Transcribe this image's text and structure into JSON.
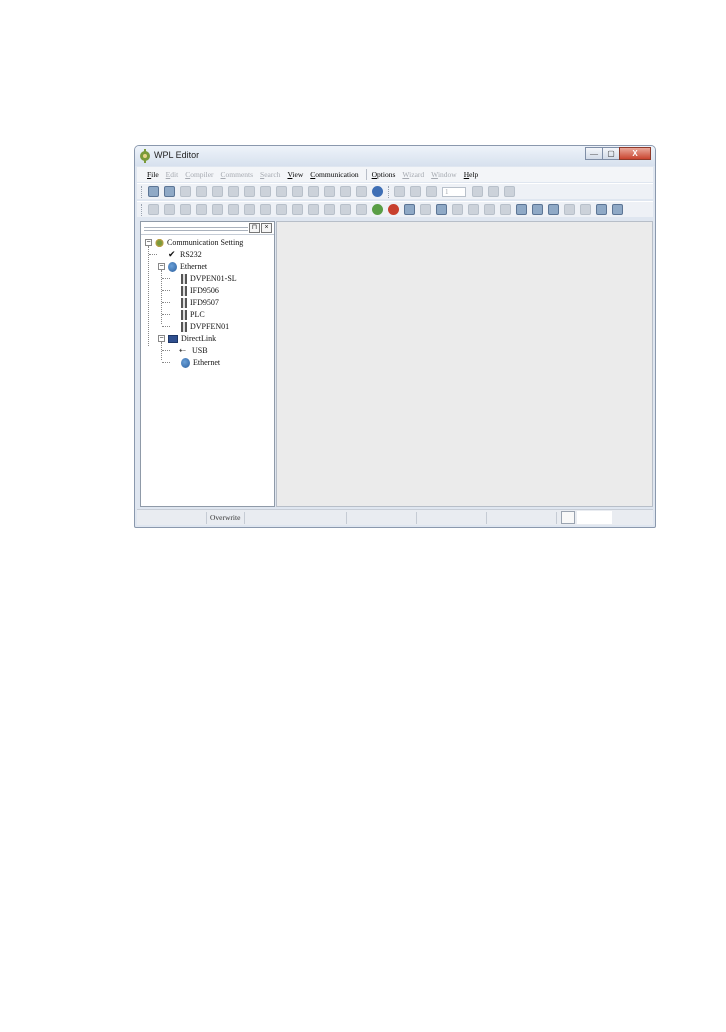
{
  "window": {
    "title": "WPL Editor",
    "controls": {
      "minimize": "—",
      "maximize": "▢",
      "close": "X"
    }
  },
  "menu": [
    {
      "label": "File",
      "enabled": true
    },
    {
      "label": "Edit",
      "enabled": false
    },
    {
      "label": "Compiler",
      "enabled": false
    },
    {
      "label": "Comments",
      "enabled": false
    },
    {
      "label": "Search",
      "enabled": false
    },
    {
      "label": "View",
      "enabled": true
    },
    {
      "label": "Communication",
      "enabled": true
    },
    {
      "label": "Options",
      "enabled": true
    },
    {
      "label": "Wizard",
      "enabled": false
    },
    {
      "label": "Window",
      "enabled": false
    },
    {
      "label": "Help",
      "enabled": true
    }
  ],
  "toolbar": {
    "step_value": "1"
  },
  "tree": {
    "root": "Communication Setting",
    "rs232": "RS232",
    "ethernet": "Ethernet",
    "ethernet_children": [
      "DVPEN01-SL",
      "IFD9506",
      "IFD9507",
      "PLC",
      "DVPFEN01"
    ],
    "directlink": "DirectLink",
    "directlink_children": [
      "USB",
      "Ethernet"
    ]
  },
  "statusbar": {
    "mode": "Overwrite"
  }
}
